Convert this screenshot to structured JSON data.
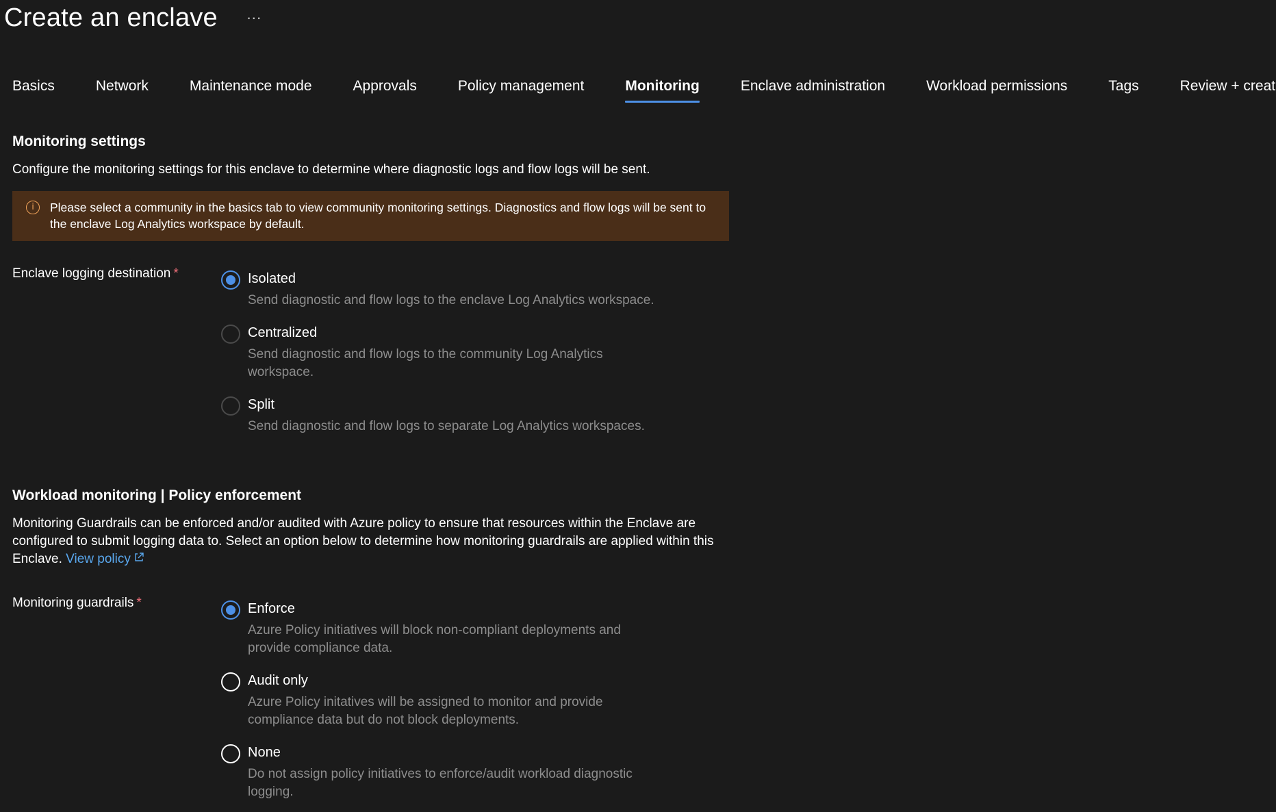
{
  "header": {
    "title": "Create an enclave",
    "more_label": "···"
  },
  "tabs": [
    {
      "label": "Basics",
      "active": false
    },
    {
      "label": "Network",
      "active": false
    },
    {
      "label": "Maintenance mode",
      "active": false
    },
    {
      "label": "Approvals",
      "active": false
    },
    {
      "label": "Policy management",
      "active": false
    },
    {
      "label": "Monitoring",
      "active": true
    },
    {
      "label": "Enclave administration",
      "active": false
    },
    {
      "label": "Workload permissions",
      "active": false
    },
    {
      "label": "Tags",
      "active": false
    },
    {
      "label": "Review + create",
      "active": false
    }
  ],
  "monitoring": {
    "heading": "Monitoring settings",
    "description": "Configure the monitoring settings for this enclave to determine where diagnostic logs and flow logs will be sent.",
    "notice": {
      "icon": "info-icon",
      "icon_glyph": "i",
      "text": "Please select a community in the basics tab to view community monitoring settings. Diagnostics and flow logs will be sent to the enclave Log Analytics workspace by default."
    },
    "logging_destination": {
      "label": "Enclave logging destination",
      "required_mark": "*",
      "options": [
        {
          "label": "Isolated",
          "description": "Send diagnostic and flow logs to the enclave Log Analytics workspace.",
          "checked": true
        },
        {
          "label": "Centralized",
          "description": "Send diagnostic and flow logs to the community Log Analytics workspace.",
          "checked": false
        },
        {
          "label": "Split",
          "description": "Send diagnostic and flow logs to separate Log Analytics workspaces.",
          "checked": false
        }
      ]
    }
  },
  "workload": {
    "heading": "Workload monitoring | Policy enforcement",
    "description": "Monitoring Guardrails can be enforced and/or audited with Azure policy to ensure that resources within the Enclave are configured to submit logging data to. Select an option below to determine how monitoring guardrails are applied within this Enclave.",
    "link_label": "View policy",
    "link_icon": "external-link-icon",
    "guardrails": {
      "label": "Monitoring guardrails",
      "required_mark": "*",
      "options": [
        {
          "label": "Enforce",
          "description": "Azure Policy initiatives will block non-compliant deployments and provide compliance data.",
          "checked": true
        },
        {
          "label": "Audit only",
          "description": "Azure Policy initatives will be assigned to monitor and provide compliance data but do not block deployments.",
          "checked": false
        },
        {
          "label": "None",
          "description": "Do not assign policy initiatives to enforce/audit workload diagnostic logging.",
          "checked": false
        }
      ]
    }
  },
  "colors": {
    "background": "#1b1b1b",
    "accent": "#4d90e6",
    "link": "#5aa9f0",
    "notice_bg": "#4a2e18",
    "notice_icon": "#f0a35a",
    "required": "#f1707b",
    "muted_text": "#8d8d8d"
  }
}
